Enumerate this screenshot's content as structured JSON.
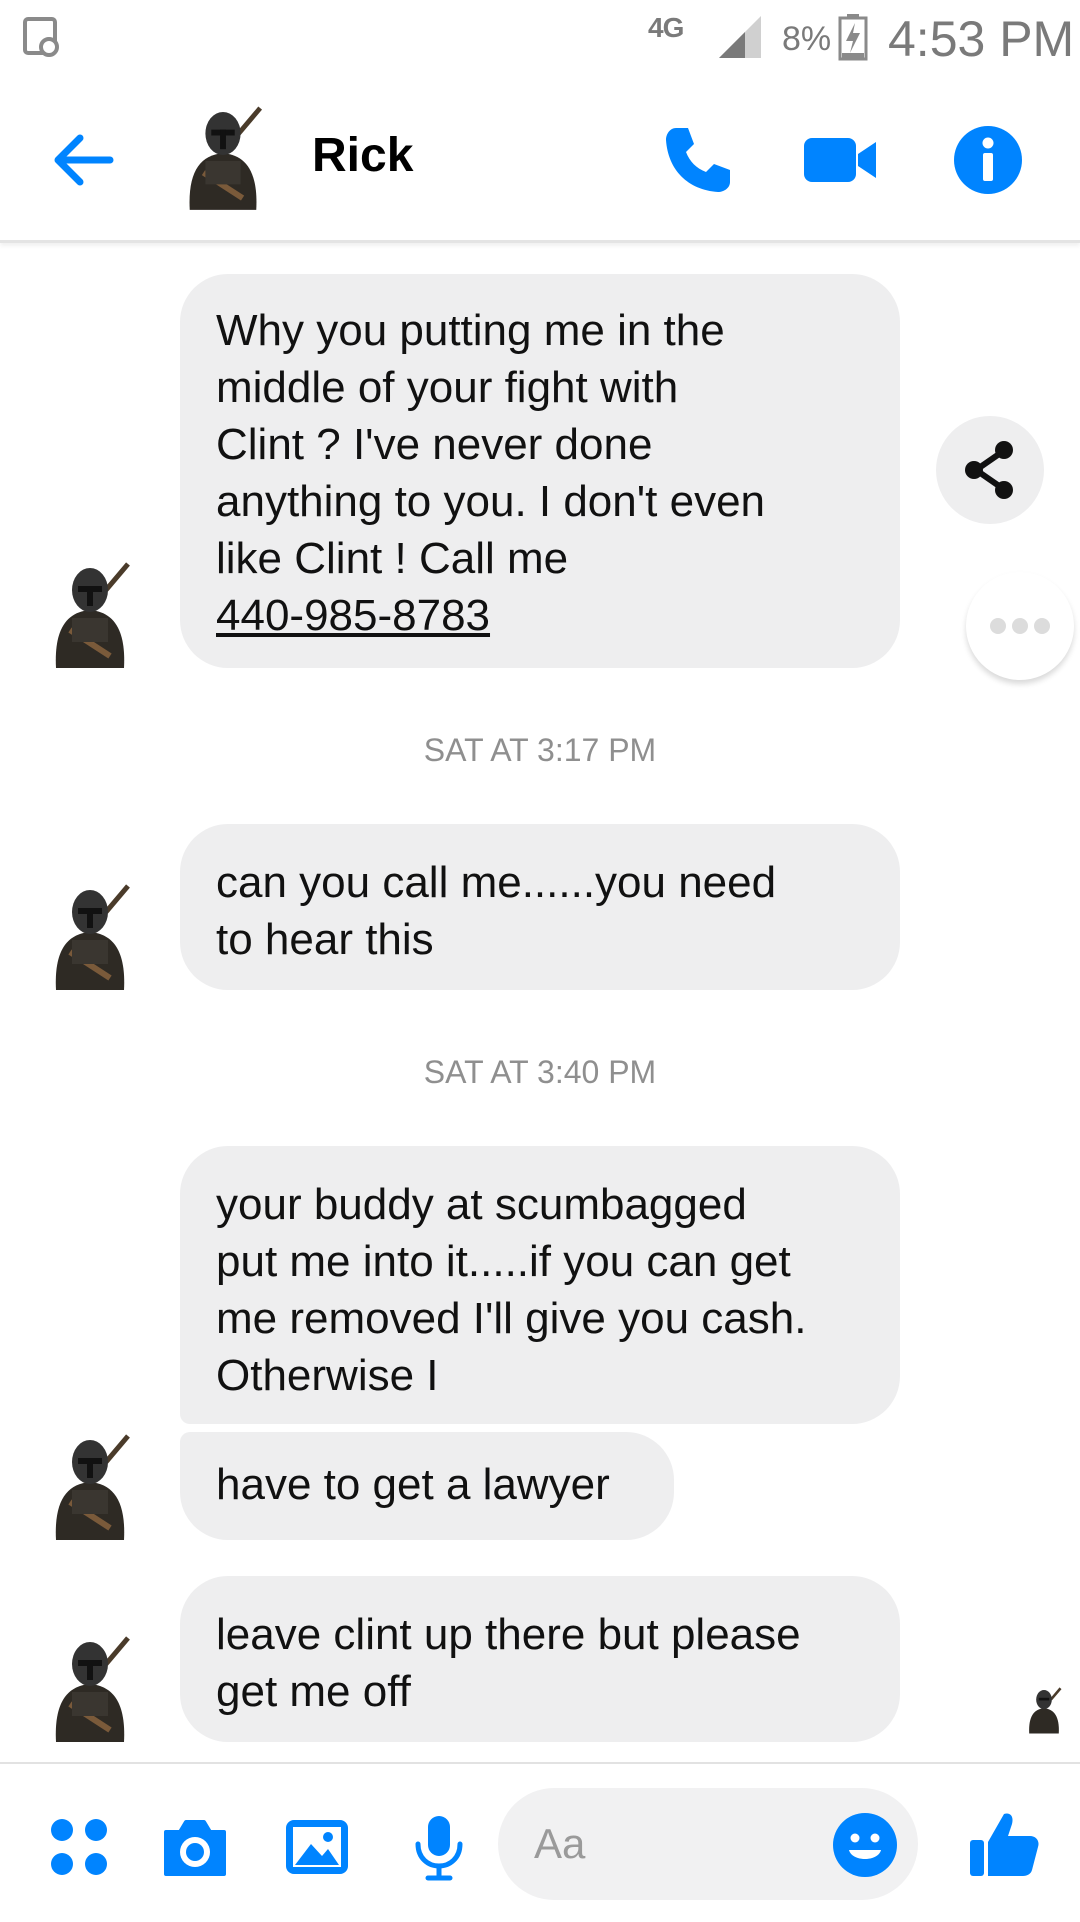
{
  "status_bar": {
    "network": "4G",
    "battery_percent": "8%",
    "time": "4:53 PM"
  },
  "header": {
    "contact_name": "Rick"
  },
  "messages": [
    {
      "text": "Why you putting me in the\nmiddle of your fight with\nClint ?  I've never done\nanything to you.  I don't even\nlike Clint !  Call me",
      "phone": "440-985-8783"
    },
    {
      "text": "can you call me......you need\nto hear this"
    },
    {
      "text": "your buddy at scumbagged\nput me into it.....if you can get\nme removed I'll give you cash.\nOtherwise I"
    },
    {
      "text": "have to get a lawyer"
    },
    {
      "text": "leave clint up there but please\nget me off"
    }
  ],
  "timestamps": [
    "SAT AT 3:17 PM",
    "SAT AT 3:40 PM"
  ],
  "composer": {
    "placeholder": "Aa"
  },
  "colors": {
    "accent": "#0084ff",
    "bubble": "#eeeeef",
    "timestamp": "#8f8f8f"
  }
}
